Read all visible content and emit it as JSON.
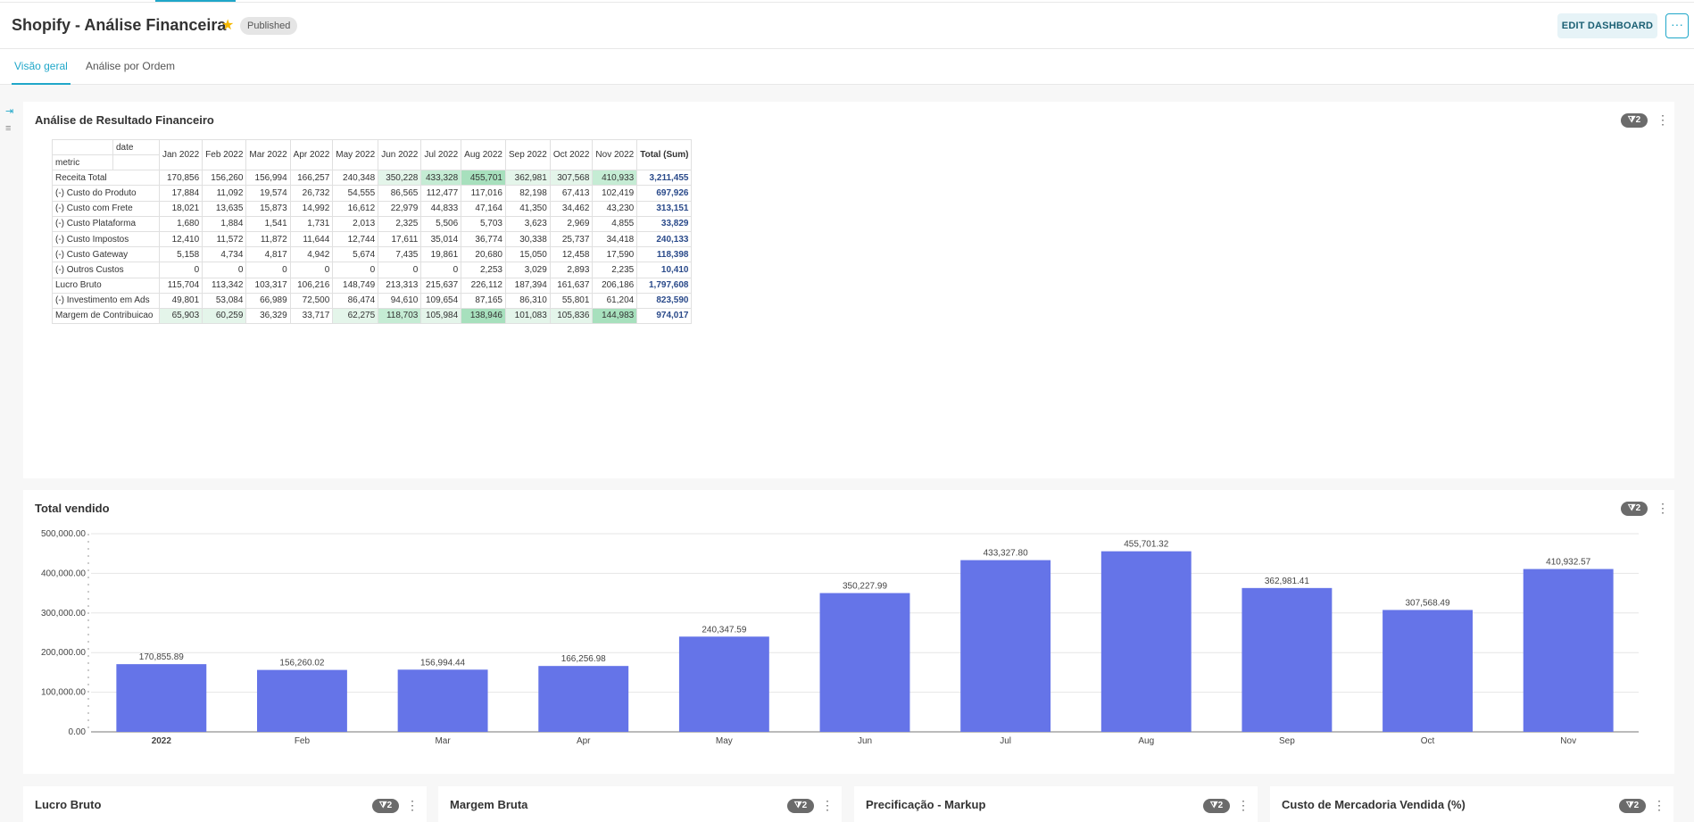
{
  "header": {
    "title": "Shopify - Análise Financeira",
    "status": "Published",
    "edit_label": "EDIT DASHBOARD",
    "more_label": "···"
  },
  "tabs": [
    {
      "label": "Visão geral"
    },
    {
      "label": "Análise por Ordem"
    }
  ],
  "panels": {
    "financial": {
      "title": "Análise de Resultado Financeiro",
      "filters": "2"
    },
    "total": {
      "title": "Total vendido",
      "filters": "2"
    },
    "lucro": {
      "title": "Lucro Bruto",
      "filters": "2"
    },
    "margem": {
      "title": "Margem Bruta",
      "filters": "2"
    },
    "markup": {
      "title": "Precificação - Markup",
      "filters": "2"
    },
    "cmv": {
      "title": "Custo de Mercadoria Vendida (%)",
      "filters": "2"
    }
  },
  "pivot": {
    "corner_col": "date",
    "corner_row": "metric",
    "columns": [
      "Jan 2022",
      "Feb 2022",
      "Mar 2022",
      "Apr 2022",
      "May 2022",
      "Jun 2022",
      "Jul 2022",
      "Aug 2022",
      "Sep 2022",
      "Oct 2022",
      "Nov 2022",
      "Total (Sum)"
    ],
    "rows": [
      {
        "label": "Receita Total",
        "values": [
          "170,856",
          "156,260",
          "156,994",
          "166,257",
          "240,348",
          "350,228",
          "433,328",
          "455,701",
          "362,981",
          "307,568",
          "410,933",
          "3,211,455"
        ],
        "shade": [
          0,
          0,
          0,
          0,
          0,
          1,
          2,
          3,
          1,
          1,
          2
        ]
      },
      {
        "label": "(-) Custo do Produto",
        "values": [
          "17,884",
          "11,092",
          "19,574",
          "26,732",
          "54,555",
          "86,565",
          "112,477",
          "117,016",
          "82,198",
          "67,413",
          "102,419",
          "697,926"
        ],
        "shade": [
          0,
          0,
          0,
          0,
          0,
          0,
          0,
          0,
          0,
          0,
          0
        ]
      },
      {
        "label": "(-) Custo com Frete",
        "values": [
          "18,021",
          "13,635",
          "15,873",
          "14,992",
          "16,612",
          "22,979",
          "44,833",
          "47,164",
          "41,350",
          "34,462",
          "43,230",
          "313,151"
        ],
        "shade": [
          0,
          0,
          0,
          0,
          0,
          0,
          0,
          0,
          0,
          0,
          0
        ]
      },
      {
        "label": "(-) Custo Plataforma",
        "values": [
          "1,680",
          "1,884",
          "1,541",
          "1,731",
          "2,013",
          "2,325",
          "5,506",
          "5,703",
          "3,623",
          "2,969",
          "4,855",
          "33,829"
        ],
        "shade": [
          0,
          0,
          0,
          0,
          0,
          0,
          0,
          0,
          0,
          0,
          0
        ]
      },
      {
        "label": "(-) Custo Impostos",
        "values": [
          "12,410",
          "11,572",
          "11,872",
          "11,644",
          "12,744",
          "17,611",
          "35,014",
          "36,774",
          "30,338",
          "25,737",
          "34,418",
          "240,133"
        ],
        "shade": [
          0,
          0,
          0,
          0,
          0,
          0,
          0,
          0,
          0,
          0,
          0
        ]
      },
      {
        "label": "(-) Custo Gateway",
        "values": [
          "5,158",
          "4,734",
          "4,817",
          "4,942",
          "5,674",
          "7,435",
          "19,861",
          "20,680",
          "15,050",
          "12,458",
          "17,590",
          "118,398"
        ],
        "shade": [
          0,
          0,
          0,
          0,
          0,
          0,
          0,
          0,
          0,
          0,
          0
        ]
      },
      {
        "label": "(-) Outros Custos",
        "values": [
          "0",
          "0",
          "0",
          "0",
          "0",
          "0",
          "0",
          "2,253",
          "3,029",
          "2,893",
          "2,235",
          "10,410"
        ],
        "shade": [
          0,
          0,
          0,
          0,
          0,
          0,
          0,
          0,
          0,
          0,
          0
        ]
      },
      {
        "label": "Lucro Bruto",
        "values": [
          "115,704",
          "113,342",
          "103,317",
          "106,216",
          "148,749",
          "213,313",
          "215,637",
          "226,112",
          "187,394",
          "161,637",
          "206,186",
          "1,797,608"
        ],
        "shade": [
          0,
          0,
          0,
          0,
          0,
          0,
          0,
          0,
          0,
          0,
          0
        ]
      },
      {
        "label": "(-) Investimento em Ads",
        "values": [
          "49,801",
          "53,084",
          "66,989",
          "72,500",
          "86,474",
          "94,610",
          "109,654",
          "87,165",
          "86,310",
          "55,801",
          "61,204",
          "823,590"
        ],
        "shade": [
          0,
          0,
          0,
          0,
          0,
          0,
          0,
          0,
          0,
          0,
          0
        ]
      },
      {
        "label": "Margem de Contribuicao",
        "values": [
          "65,903",
          "60,259",
          "36,329",
          "33,717",
          "62,275",
          "118,703",
          "105,984",
          "138,946",
          "101,083",
          "105,836",
          "144,983",
          "974,017"
        ],
        "shade": [
          1,
          1,
          0,
          0,
          1,
          2,
          1,
          3,
          1,
          1,
          3
        ]
      }
    ],
    "shade_colors": [
      "#ffffff",
      "#e4f5ea",
      "#c5ecd4",
      "#a7e0bd"
    ]
  },
  "chart_data": {
    "type": "bar",
    "title": "Total vendido",
    "categories": [
      "2022",
      "Feb",
      "Mar",
      "Apr",
      "May",
      "Jun",
      "Jul",
      "Aug",
      "Sep",
      "Oct",
      "Nov"
    ],
    "values": [
      170855.89,
      156260.02,
      156994.44,
      166256.98,
      240347.59,
      350227.99,
      433327.8,
      455701.32,
      362981.41,
      307568.49,
      410932.57
    ],
    "value_labels": [
      "170,855.89",
      "156,260.02",
      "156,994.44",
      "166,256.98",
      "240,347.59",
      "350,227.99",
      "433,327.80",
      "455,701.32",
      "362,981.41",
      "307,568.49",
      "410,932.57"
    ],
    "ylim": [
      0,
      500000
    ],
    "y_ticks": [
      0,
      100000,
      200000,
      300000,
      400000,
      500000
    ],
    "y_tick_labels": [
      "0.00",
      "100,000.00",
      "200,000.00",
      "300,000.00",
      "400,000.00",
      "500,000.00"
    ],
    "bar_color": "#6574e8",
    "grid": true
  }
}
